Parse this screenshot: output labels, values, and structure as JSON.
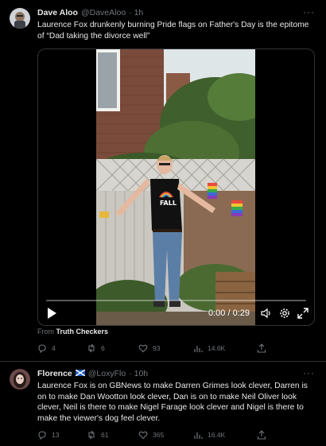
{
  "tweet1": {
    "name": "Dave Aloo",
    "handle": "@DaveAloo",
    "dot_time": "· 1h",
    "text": "Laurence Fox drunkenly burning  Pride flags on Father's Day is the epitome of “Dad taking the divorce well”",
    "video": {
      "timecode": "0:00 / 0:29",
      "progress": 0.0,
      "shirt_text": "FALL"
    },
    "from_label": "From",
    "from_source": "Truth Checkers",
    "stats": {
      "replies": "4",
      "retweets": "6",
      "likes": "93",
      "views": "14.6K"
    }
  },
  "tweet2": {
    "name": "Florence",
    "flag": "🏴",
    "handle": "@LoxyFlo",
    "dot_time": "· 10h",
    "text": "Laurence Fox is on GBNews to make Darren Grimes look clever, Darren is on to make Dan Wootton look clever, Dan is on to make Neil Oliver look clever, Neil is there to make Nigel Farage look clever and Nigel is there to make the viewer's dog feel clever.",
    "stats": {
      "replies": "13",
      "retweets": "61",
      "likes": "365",
      "views": "16.4K"
    }
  },
  "icons": [
    "reply-icon",
    "retweet-icon",
    "like-icon",
    "views-icon",
    "share-icon",
    "play-icon",
    "volume-icon",
    "settings-icon",
    "fullscreen-icon",
    "more-icon"
  ],
  "colors": {
    "background": "#000000",
    "text": "#e7e9ea",
    "secondary": "#71767b",
    "divider": "#2f3336"
  }
}
